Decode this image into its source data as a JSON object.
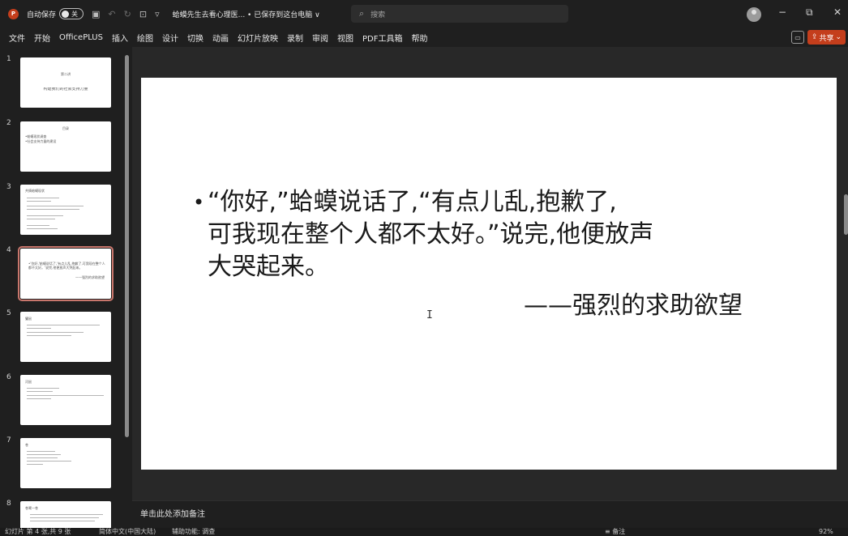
{
  "titlebar": {
    "autosave_label": "自动保存",
    "autosave_state": "关",
    "document_title": "蛤蟆先生去看心理医... • 已保存到这台电脑 ∨",
    "search_placeholder": "搜索",
    "minimize": "−",
    "restore": "⧉",
    "close": "✕"
  },
  "menu": {
    "items": [
      "文件",
      "开始",
      "OfficePLUS",
      "插入",
      "绘图",
      "设计",
      "切换",
      "动画",
      "幻灯片放映",
      "录制",
      "审阅",
      "视图",
      "PDF工具箱",
      "帮助"
    ],
    "share_label": "共享",
    "comment_icon": "💬"
  },
  "thumbnails": [
    {
      "num": "1",
      "lines": [
        "第二讲",
        "构建我们的社会支持力量"
      ]
    },
    {
      "num": "2",
      "lines": [
        "目录",
        "•蛤蟆现状调查",
        "•社会支持力量的建设"
      ]
    },
    {
      "num": "3",
      "lines": [
        "共情蛤蟆现状"
      ]
    },
    {
      "num": "4",
      "lines": [
        "•'你好,'蛤蟆说话了,'有点儿乱,抱歉了,可我现在整个人都不太好。'说完,他便放声大哭起来。",
        "——强烈的求助欲望"
      ]
    },
    {
      "num": "5",
      "lines": [
        "獾鼠"
      ]
    },
    {
      "num": "6",
      "lines": [
        "河鼠"
      ]
    },
    {
      "num": "7",
      "lines": [
        "苍"
      ]
    },
    {
      "num": "8",
      "lines": [
        "苍鹭一苍"
      ]
    }
  ],
  "slide": {
    "body_line1": "“你好,”蛤蟆说话了,“有点儿乱,抱歉了,",
    "body_line2": "可我现在整个人都不太好。”说完,他便放声",
    "body_line3": "大哭起来。",
    "attribution": "——强烈的求助欲望"
  },
  "notes": {
    "placeholder": "单击此处添加备注"
  },
  "status": {
    "slide_info": "幻灯片 第 4 张,共 9 张",
    "language": "简体中文(中国大陆)",
    "accessibility": "辅助功能: 调查",
    "notes_btn": "≡ 备注",
    "zoom": "92%"
  }
}
